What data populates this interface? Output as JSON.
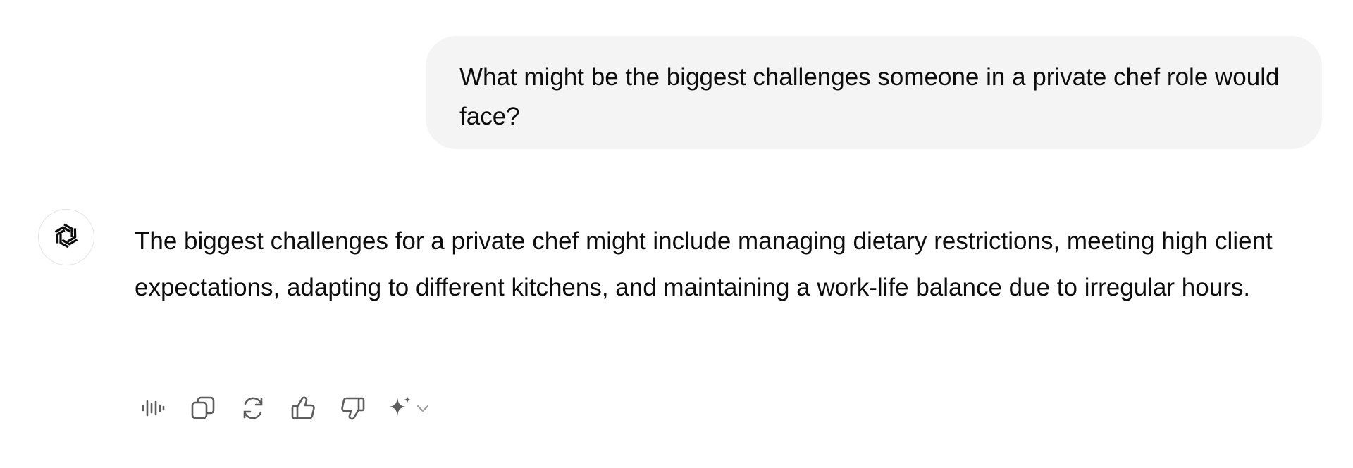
{
  "conversation": {
    "user_message": "What might be the biggest challenges someone in a private chef role would face?",
    "assistant_message": "The biggest challenges for a private chef might include managing dietary restrictions, meeting high client expectations, adapting to different kitchens, and maintaining a work-life balance due to irregular hours."
  },
  "assistant": {
    "avatar_icon": "openai-logo-icon"
  },
  "actions": [
    {
      "icon": "read-aloud-icon"
    },
    {
      "icon": "copy-icon"
    },
    {
      "icon": "regenerate-icon"
    },
    {
      "icon": "thumbs-up-icon"
    },
    {
      "icon": "thumbs-down-icon"
    },
    {
      "icon": "sparkle-icon"
    },
    {
      "icon": "chevron-down-icon"
    }
  ],
  "colors": {
    "bubble_bg": "#f4f4f4",
    "text": "#0d0d0d",
    "icon": "#5d5d5d",
    "avatar_border": "#e5e5e5"
  }
}
